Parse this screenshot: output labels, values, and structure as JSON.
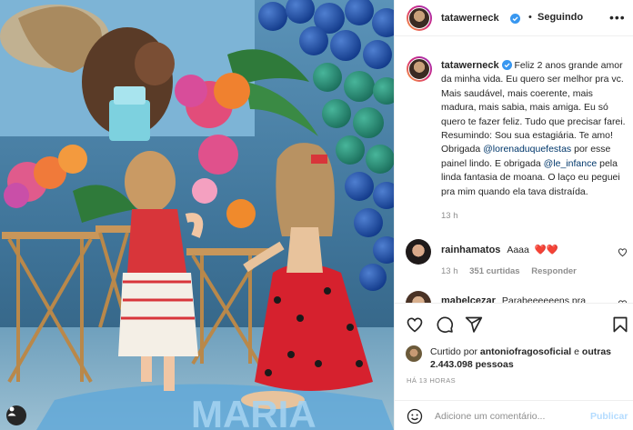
{
  "post": {
    "author": "tatawerneck",
    "follow_separator": "•",
    "follow_status": "Seguindo",
    "more_glyph": "•••",
    "caption_parts": {
      "p1": "Feliz 2 anos grande amor da minha vida. Eu quero ser melhor pra vc. Mais saudável, mais coerente, mais madura, mais sabia, mais amiga. Eu só quero te fazer feliz. Tudo que precisar farei. Resumindo: Sou sua estagiária. Te amo! Obrigada ",
      "m1": "@lorenaduquefestas",
      "p2": " por esse painel lindo. E obrigada ",
      "m2": "@le_infance",
      "p3": " pela linda fantasia de moana. O laço eu peguei pra mim quando ela tava distraída."
    },
    "caption_time": "13 h",
    "photo_banner_text": "MARIA"
  },
  "comments": [
    {
      "user": "rainhamatos",
      "text": "Aaaa",
      "emoji": "❤️❤️",
      "time": "13 h",
      "likes": "351 curtidas",
      "reply": "Responder"
    },
    {
      "user": "mabelcezar",
      "text": "Parabeeeeeens pra",
      "emoji": "",
      "time": "",
      "likes": "",
      "reply": ""
    }
  ],
  "likes": {
    "prefix": "Curtido por",
    "user": "antoniofragosoficial",
    "middle": "e",
    "others": "outras 2.443.098 pessoas"
  },
  "post_time": "HÁ 13 HORAS",
  "comment_box": {
    "placeholder": "Adicione um comentário...",
    "publish": "Publicar"
  },
  "colors": {
    "verified": "#3897f0",
    "link": "#00376b",
    "muted": "#8e8e8e",
    "like_red": "#ed4956",
    "publish_disabled": "#b3dbff"
  },
  "icons": {
    "verified": "verified-badge-icon",
    "heart": "heart-icon",
    "comment": "comment-icon",
    "share": "paper-plane-icon",
    "save": "bookmark-icon",
    "emoji": "smiley-icon",
    "user_tag": "person-icon"
  }
}
